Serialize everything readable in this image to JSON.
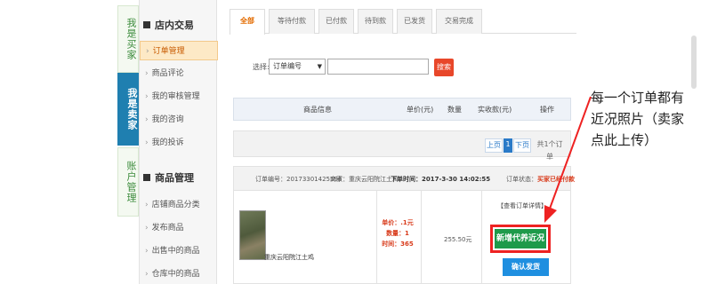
{
  "roles": {
    "buyer": "我是买家",
    "seller": "我是卖家",
    "account": "账户管理"
  },
  "sidebar": {
    "section1_title": "店内交易",
    "section1_items": [
      "订单管理",
      "商品评论",
      "我的审核管理",
      "我的咨询",
      "我的投诉"
    ],
    "section2_title": "商品管理",
    "section2_items": [
      "店铺商品分类",
      "发布商品",
      "出售中的商品",
      "仓库中的商品"
    ]
  },
  "tabs": [
    "全部",
    "等待付款",
    "已付款",
    "待到款",
    "已发货",
    "交易完成"
  ],
  "search": {
    "label": "选择:",
    "select_value": "订单编号",
    "button": "搜索"
  },
  "table_headers": {
    "product": "商品信息",
    "unit_price": "单价(元)",
    "quantity": "数量",
    "paid": "实收款(元)",
    "action": "操作"
  },
  "pager": {
    "prev": "上页",
    "current": "1",
    "next": "下页",
    "total": "共1个订单"
  },
  "order": {
    "number_label": "订单编号：",
    "number": "20173301425596",
    "shop_label": "商家：",
    "shop": "重庆云阳院江土鸡",
    "time_label": "下单时间：",
    "time": "2017-3-30 14:02:55",
    "status_label": "订单状态：",
    "status": "买家已经付款",
    "product_name": "重庆云阳院江土鸡",
    "unit_price_line": "单价：.1元",
    "quantity_line": "数量：1",
    "time_line": "时间：365",
    "amount": "255.50元",
    "detail_link": "【查看订单详情】",
    "cert_button": "新增代养近况",
    "ship_button": "确认发货"
  },
  "annotation": "每一个订单都有近况照片（卖家点此上传）",
  "colors": {
    "accent_orange": "#e36b00",
    "seller_blue": "#1f7fb0",
    "cert_green": "#1e9a4a",
    "ship_blue": "#1f8fe0",
    "highlight_red": "#e22"
  }
}
